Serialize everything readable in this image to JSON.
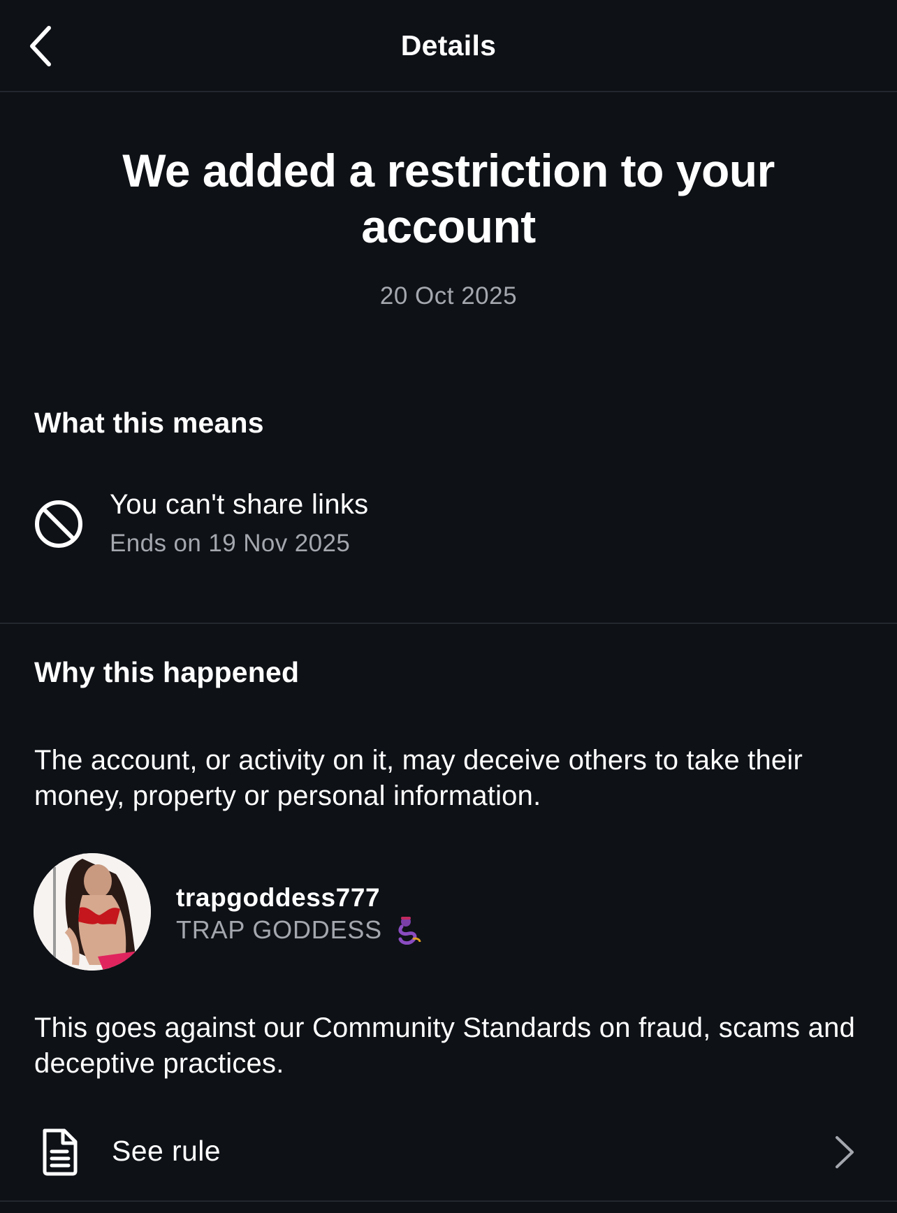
{
  "header": {
    "title": "Details"
  },
  "notice": {
    "headline": "We added a restriction to your account",
    "date": "20 Oct 2025"
  },
  "what_this_means": {
    "title": "What this means",
    "restriction": {
      "icon": "prohibited-icon",
      "label": "You can't share links",
      "ends": "Ends on 19 Nov 2025"
    }
  },
  "why_this_happened": {
    "title": "Why this happened",
    "reason": "The account, or activity on it, may deceive others to take their money, property or personal information.",
    "account": {
      "username": "trapgoddess777",
      "display_name": "TRAP GODDESS",
      "emoji_icon": "genie-icon"
    },
    "standard": "This goes against our Community Standards on fraud, scams and deceptive practices."
  },
  "see_rule": {
    "label": "See rule",
    "icon": "document-icon"
  },
  "colors": {
    "background": "#0e1116",
    "text_primary": "#ffffff",
    "text_secondary": "#a4a8ae",
    "divider": "#23272e"
  }
}
